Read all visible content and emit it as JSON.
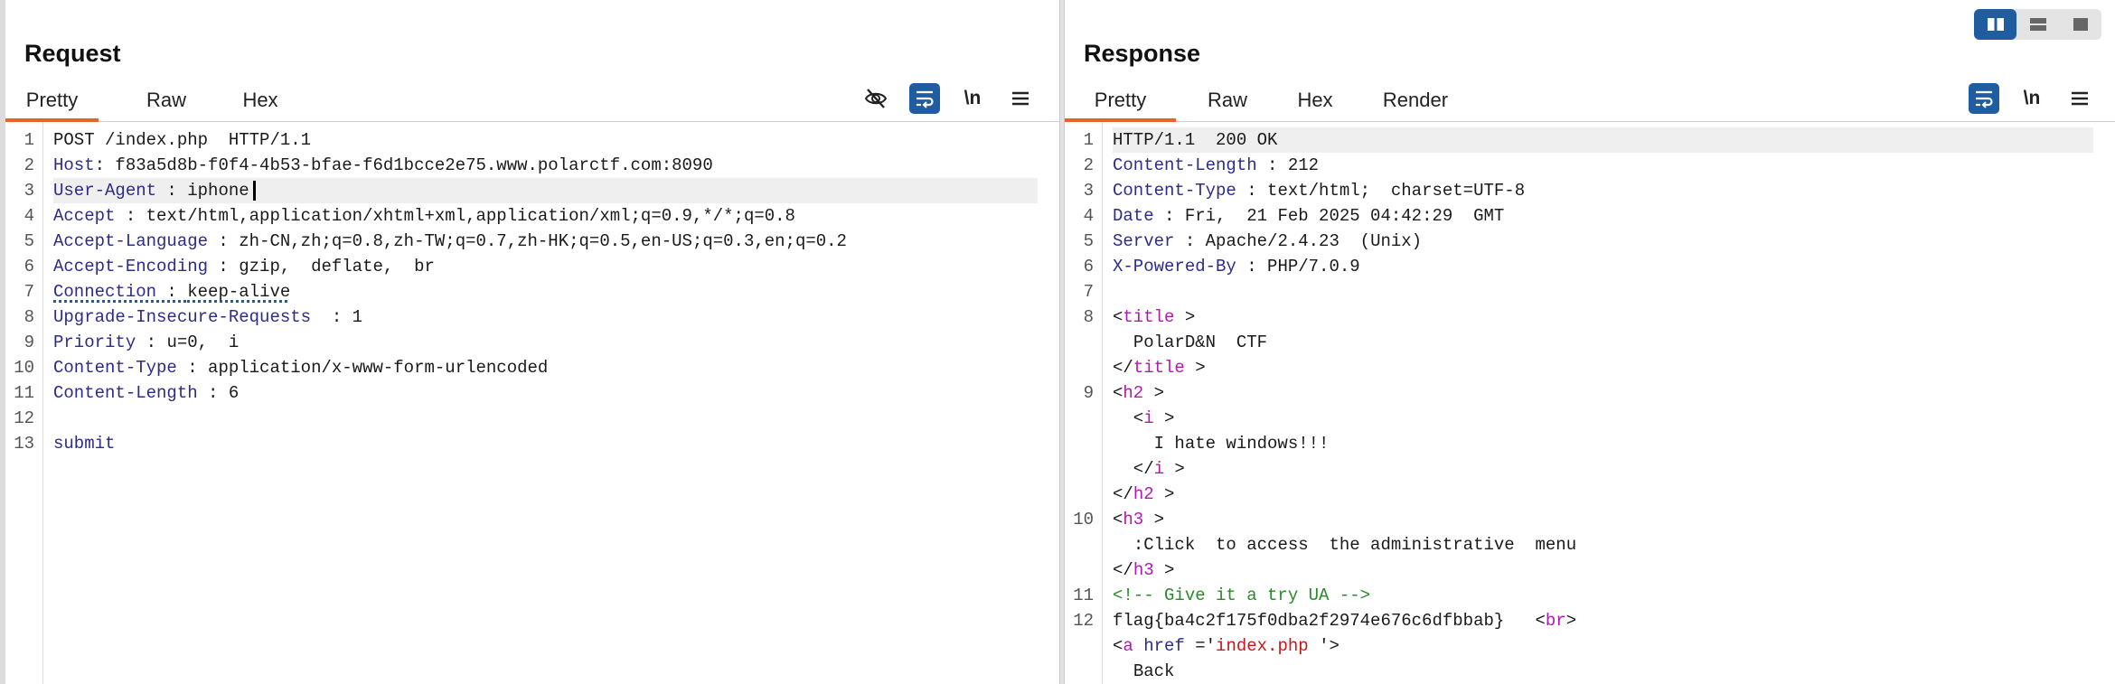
{
  "request": {
    "title": "Request",
    "tabs": [
      "Pretty",
      "Raw",
      "Hex"
    ],
    "active_tab": "Pretty",
    "tools": {
      "wrap": "\\n"
    },
    "lines": [
      {
        "n": "1",
        "name": "POST /index.php  HTTP/1.1",
        "sep": "",
        "value": ""
      },
      {
        "n": "2",
        "name": "Host",
        "sep": ": ",
        "value": "f83a5d8b-f0f4-4b53-bfae-f6d1bcce2e75.www.polarctf.com:8090"
      },
      {
        "n": "3",
        "name": "User-Agent",
        "sep": " : ",
        "value": "iphone"
      },
      {
        "n": "4",
        "name": "Accept",
        "sep": " : ",
        "value": "text/html,application/xhtml+xml,application/xml;q=0.9,*/*;q=0.8"
      },
      {
        "n": "5",
        "name": "Accept-Language",
        "sep": " : ",
        "value": "zh-CN,zh;q=0.8,zh-TW;q=0.7,zh-HK;q=0.5,en-US;q=0.3,en;q=0.2"
      },
      {
        "n": "6",
        "name": "Accept-Encoding",
        "sep": " : ",
        "value": "gzip,  deflate,  br"
      },
      {
        "n": "7",
        "name": "Connection",
        "sep": " : ",
        "value": "keep-alive"
      },
      {
        "n": "8",
        "name": "Upgrade-Insecure-Requests",
        "sep": "  : ",
        "value": "1"
      },
      {
        "n": "9",
        "name": "Priority",
        "sep": " : ",
        "value": "u=0,  i"
      },
      {
        "n": "10",
        "name": "Content-Type",
        "sep": " : ",
        "value": "application/x-www-form-urlencoded"
      },
      {
        "n": "11",
        "name": "Content-Length",
        "sep": " : ",
        "value": "6"
      },
      {
        "n": "12",
        "name": "",
        "sep": "",
        "value": ""
      },
      {
        "n": "13",
        "name": "submit",
        "sep": "",
        "value": ""
      }
    ]
  },
  "response": {
    "title": "Response",
    "tabs": [
      "Pretty",
      "Raw",
      "Hex",
      "Render"
    ],
    "active_tab": "Pretty",
    "tools": {
      "wrap": "\\n"
    },
    "status_line": "HTTP/1.1  200 OK",
    "headers": [
      {
        "n": "2",
        "name": "Content-Length",
        "sep": " : ",
        "value": "212"
      },
      {
        "n": "3",
        "name": "Content-Type",
        "sep": " : ",
        "value": "text/html;  charset=UTF-8"
      },
      {
        "n": "4",
        "name": "Date",
        "sep": " : ",
        "value": "Fri,  21 Feb 2025 04:42:29  GMT"
      },
      {
        "n": "5",
        "name": "Server",
        "sep": " : ",
        "value": "Apache/2.4.23  (Unix)"
      },
      {
        "n": "6",
        "name": "X-Powered-By",
        "sep": " : ",
        "value": "PHP/7.0.9"
      }
    ],
    "body": {
      "title_text": "PolarD&N  CTF",
      "h2_text": "I hate windows!!!",
      "h3_text": ":Click  to access  the administrative  menu",
      "comment": "<!-- Give it a try UA -->",
      "flag": "flag{ba4c2f175f0dba2f2974e676c6dfbbab}",
      "href_value": "index.php",
      "link_text": "Back"
    }
  },
  "layout_switch": [
    "split-horizontal",
    "split-vertical",
    "single"
  ]
}
